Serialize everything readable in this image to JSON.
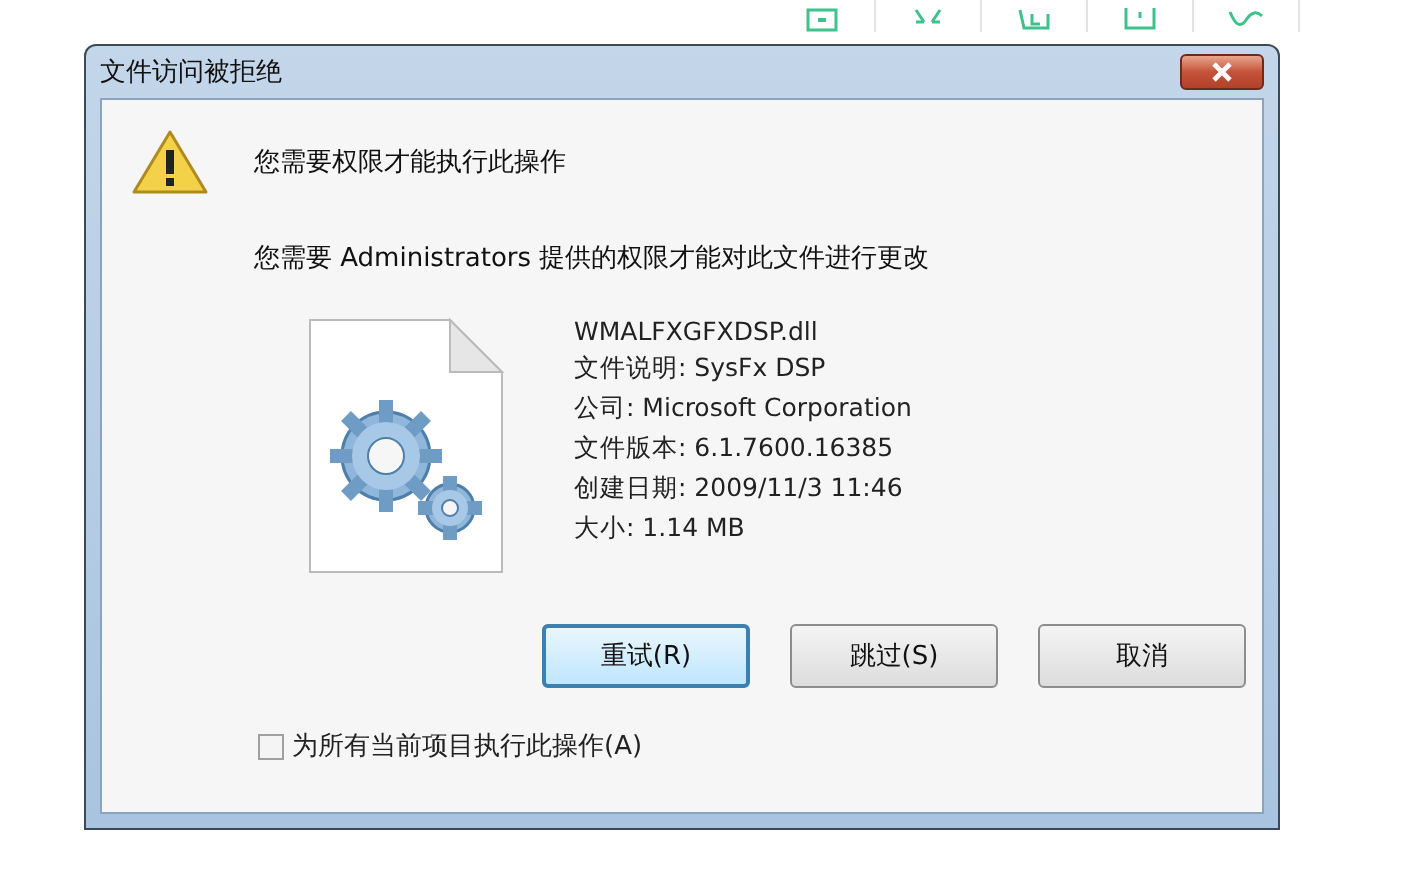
{
  "dialog": {
    "title": "文件访问被拒绝",
    "heading": "您需要权限才能执行此操作",
    "message": "您需要 Administrators 提供的权限才能对此文件进行更改",
    "file": {
      "name": "WMALFXGFXDSP.dll",
      "details": [
        "文件说明: SysFx DSP",
        "公司: Microsoft Corporation",
        "文件版本: 6.1.7600.16385",
        "创建日期: 2009/11/3 11:46",
        "大小: 1.14 MB"
      ]
    },
    "buttons": [
      {
        "label": "重试(R)",
        "selected": true
      },
      {
        "label": "跳过(S)",
        "selected": false
      },
      {
        "label": "取消",
        "selected": false
      }
    ],
    "apply_to_all": {
      "label": "为所有当前项目执行此操作(A)",
      "checked": false
    }
  }
}
